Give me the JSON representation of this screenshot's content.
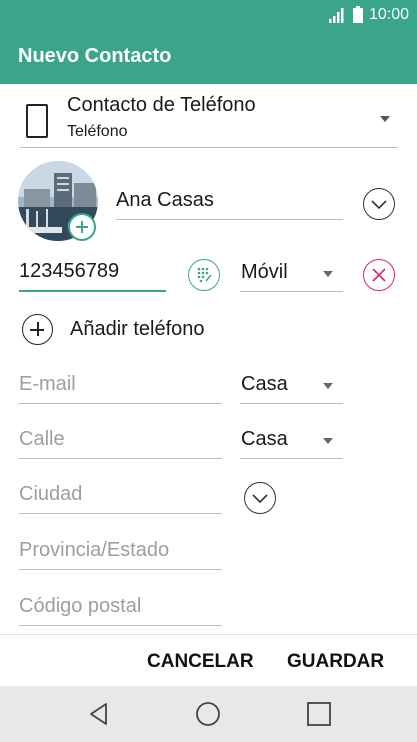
{
  "statusbar": {
    "time": "10:00"
  },
  "appbar": {
    "title": "Nuevo Contacto"
  },
  "account": {
    "title": "Contacto de Teléfono",
    "subtitle": "Teléfono"
  },
  "name": {
    "value": "Ana Casas"
  },
  "phone": {
    "value": "123456789",
    "type": "Móvil"
  },
  "add_phone": {
    "label": "Añadir teléfono"
  },
  "email": {
    "placeholder": "E-mail",
    "type": "Casa"
  },
  "street": {
    "placeholder": "Calle",
    "type": "Casa"
  },
  "city": {
    "placeholder": "Ciudad"
  },
  "state": {
    "placeholder": "Provincia/Estado"
  },
  "postal": {
    "placeholder": "Código postal"
  },
  "actions": {
    "cancel": "CANCELAR",
    "save": "GUARDAR"
  },
  "colors": {
    "accent": "#3aa58a",
    "danger": "#e0245e"
  }
}
